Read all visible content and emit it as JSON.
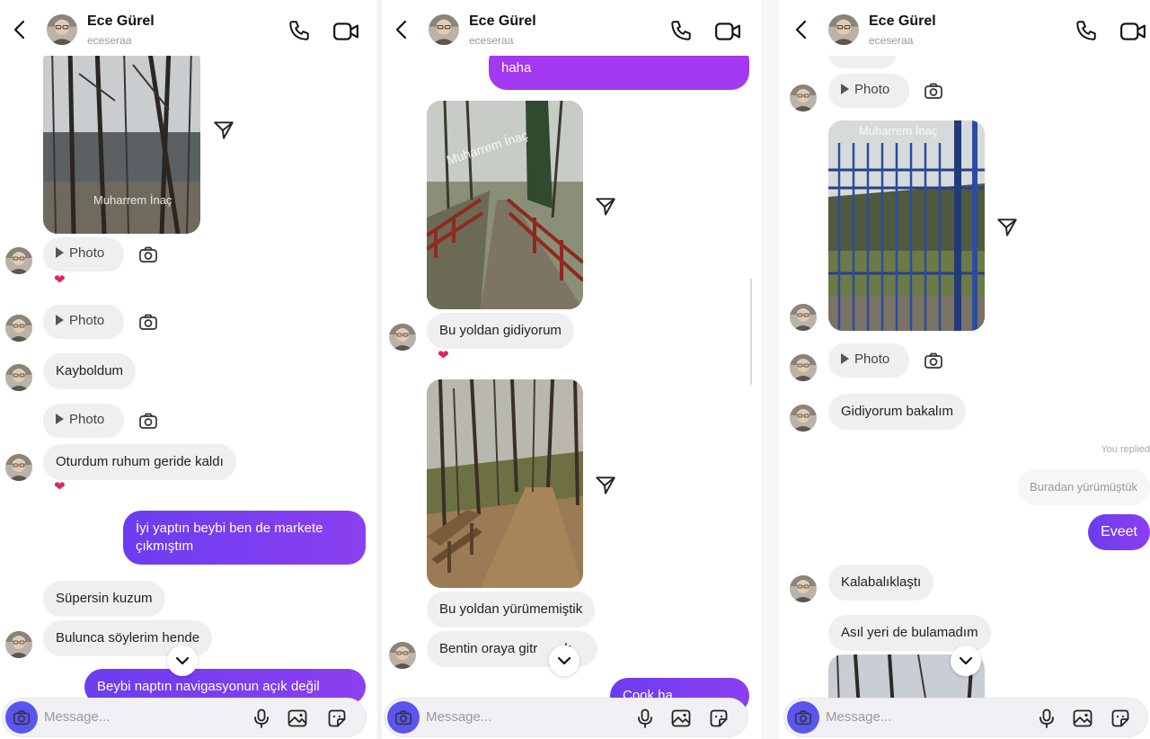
{
  "contact": {
    "name": "Ece Gürel",
    "username": "eceseraa"
  },
  "composer": {
    "placeholder": "Message..."
  },
  "photo_label": "Photo",
  "watermark": "Muharrem İnaç",
  "panel1": {
    "msg_lost": "Kayboldum",
    "msg_sat": "Oturdum ruhum geride kaldı",
    "msg_sent1": "İyi yaptın beybi ben de markete çıkmıştım",
    "msg_great": "Süpersin kuzum",
    "msg_tell": "Bulunca söylerim hende",
    "msg_sent2": "Beybi naptın navigasyonun açık değil"
  },
  "panel2": {
    "msg_top": "haha",
    "msg_path1": "Bu yoldan gidiyorum",
    "msg_path2": "Bu yoldan yürümemiştik",
    "msg_dam": "Bentin oraya gitr",
    "msg_dam_tail": "k",
    "msg_sent_partial": "Çook ha"
  },
  "panel3": {
    "msg_going": "Gidiyorum bakalım",
    "you_replied": "You replied",
    "reply_quote": "Buradan yürümüştük",
    "msg_yes": "Eveet",
    "msg_crowd": "Kalabalıklaştı",
    "msg_notfound": "Asıl yeri de bulamadım"
  },
  "colors": {
    "sent_bubble": "#6b3df0",
    "sent_bubble_alt": "#a238ef",
    "received_bubble": "#efeff1",
    "heart": "#e0245e",
    "camera_button": "#5b55f0"
  },
  "icons": [
    "back-icon",
    "phone-icon",
    "video-icon",
    "play-icon",
    "camera-icon",
    "share-icon",
    "chevron-down-icon",
    "microphone-icon",
    "gallery-icon",
    "sticker-icon",
    "heart-icon"
  ]
}
